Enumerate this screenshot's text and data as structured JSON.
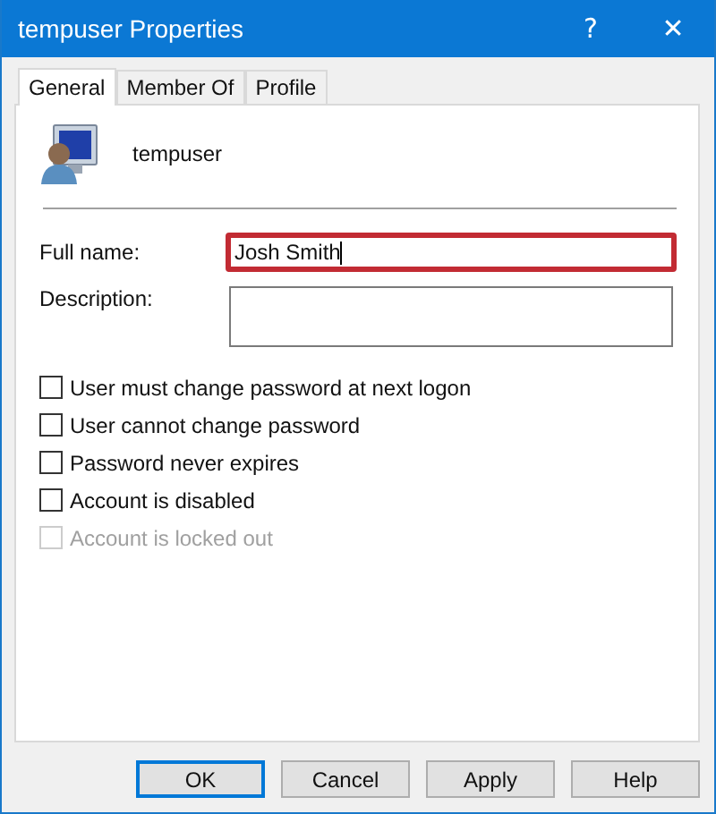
{
  "window": {
    "title": "tempuser Properties",
    "help": "?",
    "close": "✕"
  },
  "tabs": [
    {
      "label": "General",
      "selected": true
    },
    {
      "label": "Member Of",
      "selected": false
    },
    {
      "label": "Profile",
      "selected": false
    }
  ],
  "user": {
    "name": "tempuser"
  },
  "fields": [
    {
      "label": "Full name:",
      "value": "Josh Smith",
      "highlighted": true,
      "focused": true,
      "kind": "line"
    },
    {
      "label": "Description:",
      "highlighted": false,
      "focused": false,
      "kind": "box"
    }
  ],
  "options": [
    {
      "label": "User must change password at next logon",
      "checked": false,
      "disabled": false
    },
    {
      "label": "User cannot change password",
      "checked": false,
      "disabled": false
    },
    {
      "label": "Password never expires",
      "checked": false,
      "disabled": false
    },
    {
      "label": "Account is disabled",
      "checked": false,
      "disabled": false
    },
    {
      "label": "Account is locked out",
      "checked": false,
      "disabled": true
    }
  ],
  "buttons": [
    {
      "label": "OK",
      "default": true
    },
    {
      "label": "Cancel",
      "default": false
    },
    {
      "label": "Apply",
      "default": false
    },
    {
      "label": "Help",
      "default": false
    }
  ]
}
